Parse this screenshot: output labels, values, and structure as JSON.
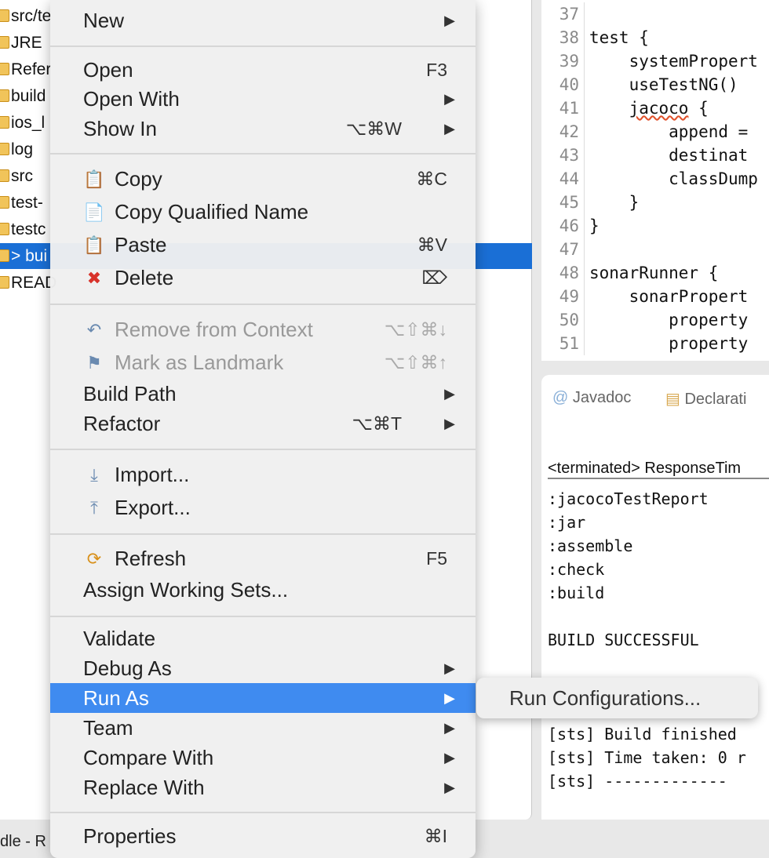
{
  "tree": {
    "items": [
      {
        "label": "src/te",
        "selected": false
      },
      {
        "label": "JRE",
        "selected": false
      },
      {
        "label": "Refer",
        "selected": false
      },
      {
        "label": "build",
        "selected": false
      },
      {
        "label": "ios_l",
        "selected": false
      },
      {
        "label": "log",
        "selected": false
      },
      {
        "label": "src",
        "selected": false
      },
      {
        "label": "test-",
        "selected": false
      },
      {
        "label": "testc",
        "selected": false
      },
      {
        "label": "> bui",
        "selected": true
      },
      {
        "label": "READ",
        "selected": false
      }
    ]
  },
  "editor": {
    "lines": [
      {
        "n": "37",
        "t": ""
      },
      {
        "n": "38",
        "t": "test {"
      },
      {
        "n": "39",
        "t": "    systemPropert"
      },
      {
        "n": "40",
        "t": "    useTestNG()"
      },
      {
        "n": "41",
        "t": "    jacoco {",
        "squiggle": "jacoco"
      },
      {
        "n": "42",
        "t": "        append ="
      },
      {
        "n": "43",
        "t": "        destinat"
      },
      {
        "n": "44",
        "t": "        classDump"
      },
      {
        "n": "45",
        "t": "    }"
      },
      {
        "n": "46",
        "t": "}"
      },
      {
        "n": "47",
        "t": ""
      },
      {
        "n": "48",
        "t": "sonarRunner {"
      },
      {
        "n": "49",
        "t": "    sonarPropert"
      },
      {
        "n": "50",
        "t": "        property"
      },
      {
        "n": "51",
        "t": "        property"
      }
    ]
  },
  "bottom": {
    "tabs": [
      {
        "label": "Javadoc",
        "icon": "at-icon"
      },
      {
        "label": "Declarati",
        "icon": "declaration-icon"
      }
    ],
    "terminated": "<terminated> ResponseTim",
    "console": [
      ":jacocoTestReport",
      ":jar",
      ":assemble",
      ":check",
      ":build",
      "",
      "BUILD SUCCESSFUL",
      "",
      "",
      "",
      "[sts] Build finished",
      "[sts] Time taken: 0 r",
      "[sts] -------------"
    ]
  },
  "status": {
    "text": "dle - R"
  },
  "menu": {
    "items": [
      {
        "label": "New",
        "arrow": true,
        "group": 0
      },
      {
        "label": "Open",
        "shortcut": "F3",
        "group": 1
      },
      {
        "label": "Open With",
        "arrow": true,
        "group": 1
      },
      {
        "label": "Show In",
        "shortcut": "⌥⌘W",
        "arrow": true,
        "group": 1
      },
      {
        "label": "Copy",
        "shortcut": "⌘C",
        "icon": "copy-icon",
        "group": 2
      },
      {
        "label": "Copy Qualified Name",
        "icon": "copy-qualified-name-icon",
        "group": 2
      },
      {
        "label": "Paste",
        "shortcut": "⌘V",
        "icon": "paste-icon",
        "group": 2
      },
      {
        "label": "Delete",
        "shortcut": "⌦",
        "icon": "delete-icon",
        "group": 2
      },
      {
        "label": "Remove from Context",
        "shortcut": "⌥⇧⌘↓",
        "icon": "remove-context-icon",
        "disabled": true,
        "group": 3
      },
      {
        "label": "Mark as Landmark",
        "shortcut": "⌥⇧⌘↑",
        "icon": "landmark-icon",
        "disabled": true,
        "group": 3
      },
      {
        "label": "Build Path",
        "arrow": true,
        "group": 3
      },
      {
        "label": "Refactor",
        "shortcut": "⌥⌘T",
        "arrow": true,
        "group": 3
      },
      {
        "label": "Import...",
        "icon": "import-icon",
        "group": 4
      },
      {
        "label": "Export...",
        "icon": "export-icon",
        "group": 4
      },
      {
        "label": "Refresh",
        "shortcut": "F5",
        "icon": "refresh-icon",
        "group": 5
      },
      {
        "label": "Assign Working Sets...",
        "group": 5
      },
      {
        "label": "Validate",
        "group": 6
      },
      {
        "label": "Debug As",
        "arrow": true,
        "group": 6
      },
      {
        "label": "Run As",
        "arrow": true,
        "highlighted": true,
        "group": 6
      },
      {
        "label": "Team",
        "arrow": true,
        "group": 6
      },
      {
        "label": "Compare With",
        "arrow": true,
        "group": 6
      },
      {
        "label": "Replace With",
        "arrow": true,
        "group": 6
      },
      {
        "label": "Properties",
        "shortcut": "⌘I",
        "group": 7
      }
    ]
  },
  "submenu": {
    "items": [
      {
        "label": "Run Configurations..."
      }
    ]
  },
  "colors": {
    "selection": "#1a6fd6",
    "menu_highlight": "#3f8bf0"
  }
}
